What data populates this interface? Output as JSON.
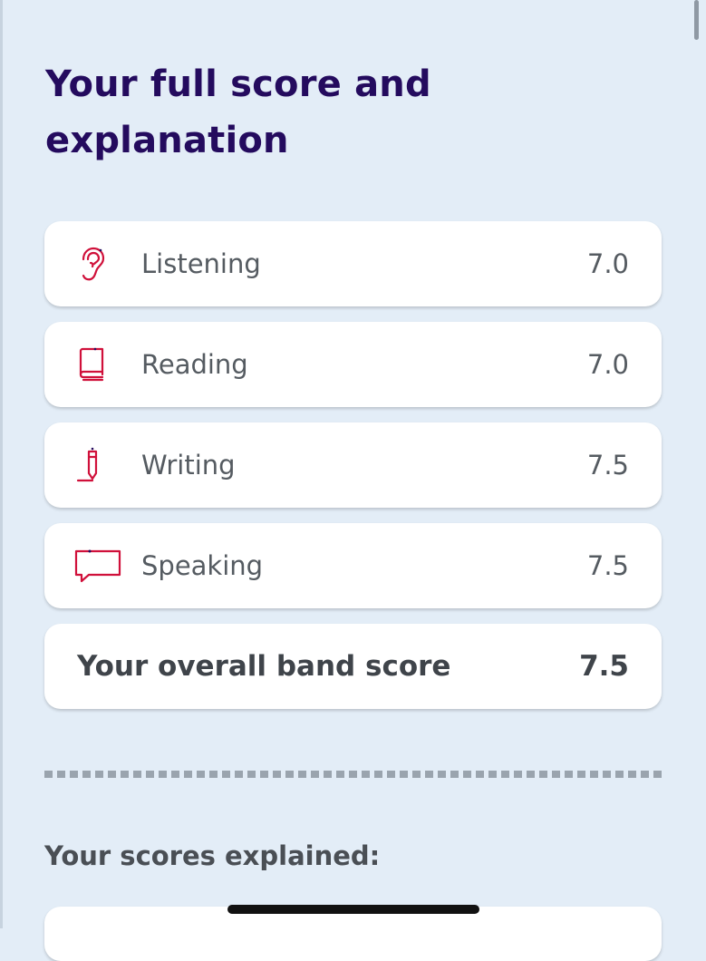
{
  "page": {
    "title_line1": "Your full score and",
    "title_line2": "explanation"
  },
  "scores": [
    {
      "label": "Listening",
      "value": "7.0",
      "icon": "ear-icon"
    },
    {
      "label": "Reading",
      "value": "7.0",
      "icon": "book-icon"
    },
    {
      "label": "Writing",
      "value": "7.5",
      "icon": "pen-icon"
    },
    {
      "label": "Speaking",
      "value": "7.5",
      "icon": "speech-bubble-icon"
    }
  ],
  "overall": {
    "label": "Your overall band score",
    "value": "7.5"
  },
  "explained": {
    "heading": "Your scores explained:"
  },
  "colors": {
    "background": "#e3edf7",
    "title": "#240b5e",
    "icon_red": "#d0103a",
    "text_gray": "#555b61"
  }
}
